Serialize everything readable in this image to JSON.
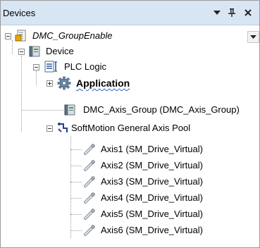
{
  "panel": {
    "title": "Devices",
    "buttons": {
      "dropdown": "▼",
      "pin": "pin-icon",
      "close": "close-icon"
    }
  },
  "tree": {
    "project": "DMC_GroupEnable",
    "device": "Device",
    "plc_logic": "PLC Logic",
    "application": "Application",
    "axis_group": "DMC_Axis_Group (DMC_Axis_Group)",
    "axis_pool": "SoftMotion General Axis Pool",
    "axes": [
      "Axis1 (SM_Drive_Virtual)",
      "Axis2 (SM_Drive_Virtual)",
      "Axis3 (SM_Drive_Virtual)",
      "Axis4 (SM_Drive_Virtual)",
      "Axis5 (SM_Drive_Virtual)",
      "Axis6 (SM_Drive_Virtual)"
    ]
  },
  "colors": {
    "header_bg": "#d8e6f4",
    "wavy_underline": "#3060d0"
  }
}
